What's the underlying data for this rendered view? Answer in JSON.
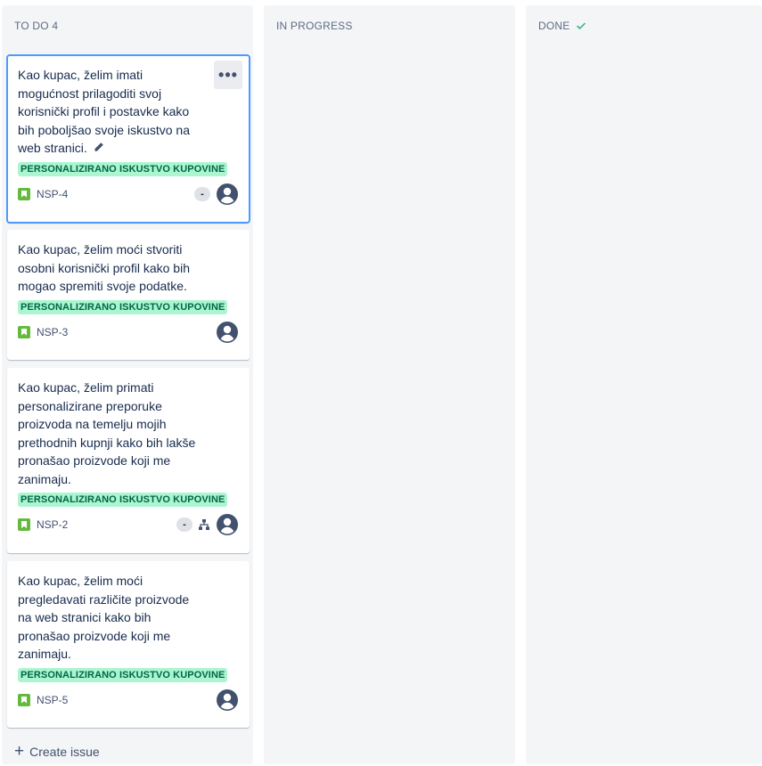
{
  "columns": {
    "todo": {
      "title": "TO DO 4"
    },
    "in_progress": {
      "title": "IN PROGRESS"
    },
    "done": {
      "title": "DONE",
      "icon": "check-icon",
      "icon_color": "#36b37e"
    }
  },
  "cards": [
    {
      "text": "Kao kupac, želim imati mogućnost prilagoditi svoj korisnički profil i postavke kako bih poboljšao svoje iskustvo na web stranici.",
      "epic": "PERSONALIZIRANO ISKUSTVO KUPOVINE",
      "key": "NSP-4",
      "estimate": "-",
      "selected": true,
      "more_label": "•••"
    },
    {
      "text": "Kao kupac, želim moći stvoriti osobni korisnički profil kako bih mogao spremiti svoje podatke.",
      "epic": "PERSONALIZIRANO ISKUSTVO KUPOVINE",
      "key": "NSP-3"
    },
    {
      "text": "Kao kupac, želim primati personalizirane preporuke proizvoda na temelju mojih prethodnih kupnji kako bih lakše pronašao proizvode koji me zanimaju.",
      "epic": "PERSONALIZIRANO ISKUSTVO KUPOVINE",
      "key": "NSP-2",
      "estimate": "-"
    },
    {
      "text": "Kao kupac, želim moći pregledavati različite proizvode na web stranici kako bih pronašao proizvode koji me zanimaju.",
      "epic": "PERSONALIZIRANO ISKUSTVO KUPOVINE",
      "key": "NSP-5"
    }
  ],
  "create_issue": {
    "label": "Create issue",
    "icon": "plus-icon"
  },
  "colors": {
    "epic_bg": "#abf5d1",
    "epic_text": "#006644",
    "story_icon": "#63ba3c",
    "selection_outline": "#4c9aff",
    "column_bg": "#f4f5f7"
  }
}
